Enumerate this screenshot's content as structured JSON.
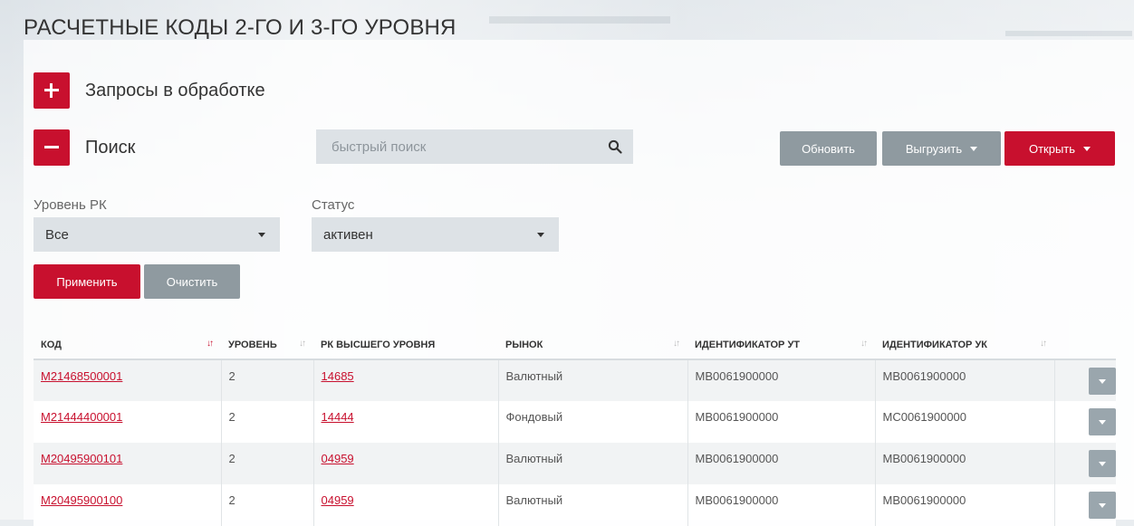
{
  "page": {
    "title": "РАСЧЕТНЫЕ КОДЫ 2-ГО И 3-ГО УРОВНЯ"
  },
  "sections": {
    "requests": {
      "label": "Запросы в обработке",
      "icon": "plus-icon"
    },
    "search": {
      "label": "Поиск",
      "icon": "minus-icon"
    }
  },
  "quick_search": {
    "placeholder": "быстрый поиск",
    "icon": "search-icon"
  },
  "toolbar": {
    "refresh_label": "Обновить",
    "export_label": "Выгрузить",
    "open_label": "Открыть"
  },
  "filters": {
    "level": {
      "label": "Уровень РК",
      "value": "Все"
    },
    "status": {
      "label": "Статус",
      "value": "активен"
    },
    "apply_label": "Применить",
    "clear_label": "Очистить"
  },
  "table": {
    "headers": [
      "КОД",
      "УРОВЕНЬ",
      "РК ВЫСШЕГО УРОВНЯ",
      "РЫНОК",
      "ИДЕНТИФИКАТОР УТ",
      "ИДЕНТИФИКАТОР УК"
    ],
    "rows": [
      {
        "code": "M21468500001",
        "level": "2",
        "parent": "14685",
        "market": "Валютный",
        "ut": "MB0061900000",
        "uk": "MB0061900000"
      },
      {
        "code": "M21444400001",
        "level": "2",
        "parent": "14444",
        "market": "Фондовый",
        "ut": "MB0061900000",
        "uk": "MC0061900000"
      },
      {
        "code": "M20495900101",
        "level": "2",
        "parent": "04959",
        "market": "Валютный",
        "ut": "MB0061900000",
        "uk": "MB0061900000"
      },
      {
        "code": "M20495900100",
        "level": "2",
        "parent": "04959",
        "market": "Валютный",
        "ut": "MB0061900000",
        "uk": "MB0061900000"
      }
    ]
  },
  "colors": {
    "accent": "#c8102e",
    "grey_button": "#8f9aa0",
    "field_bg": "#dde2e6"
  }
}
